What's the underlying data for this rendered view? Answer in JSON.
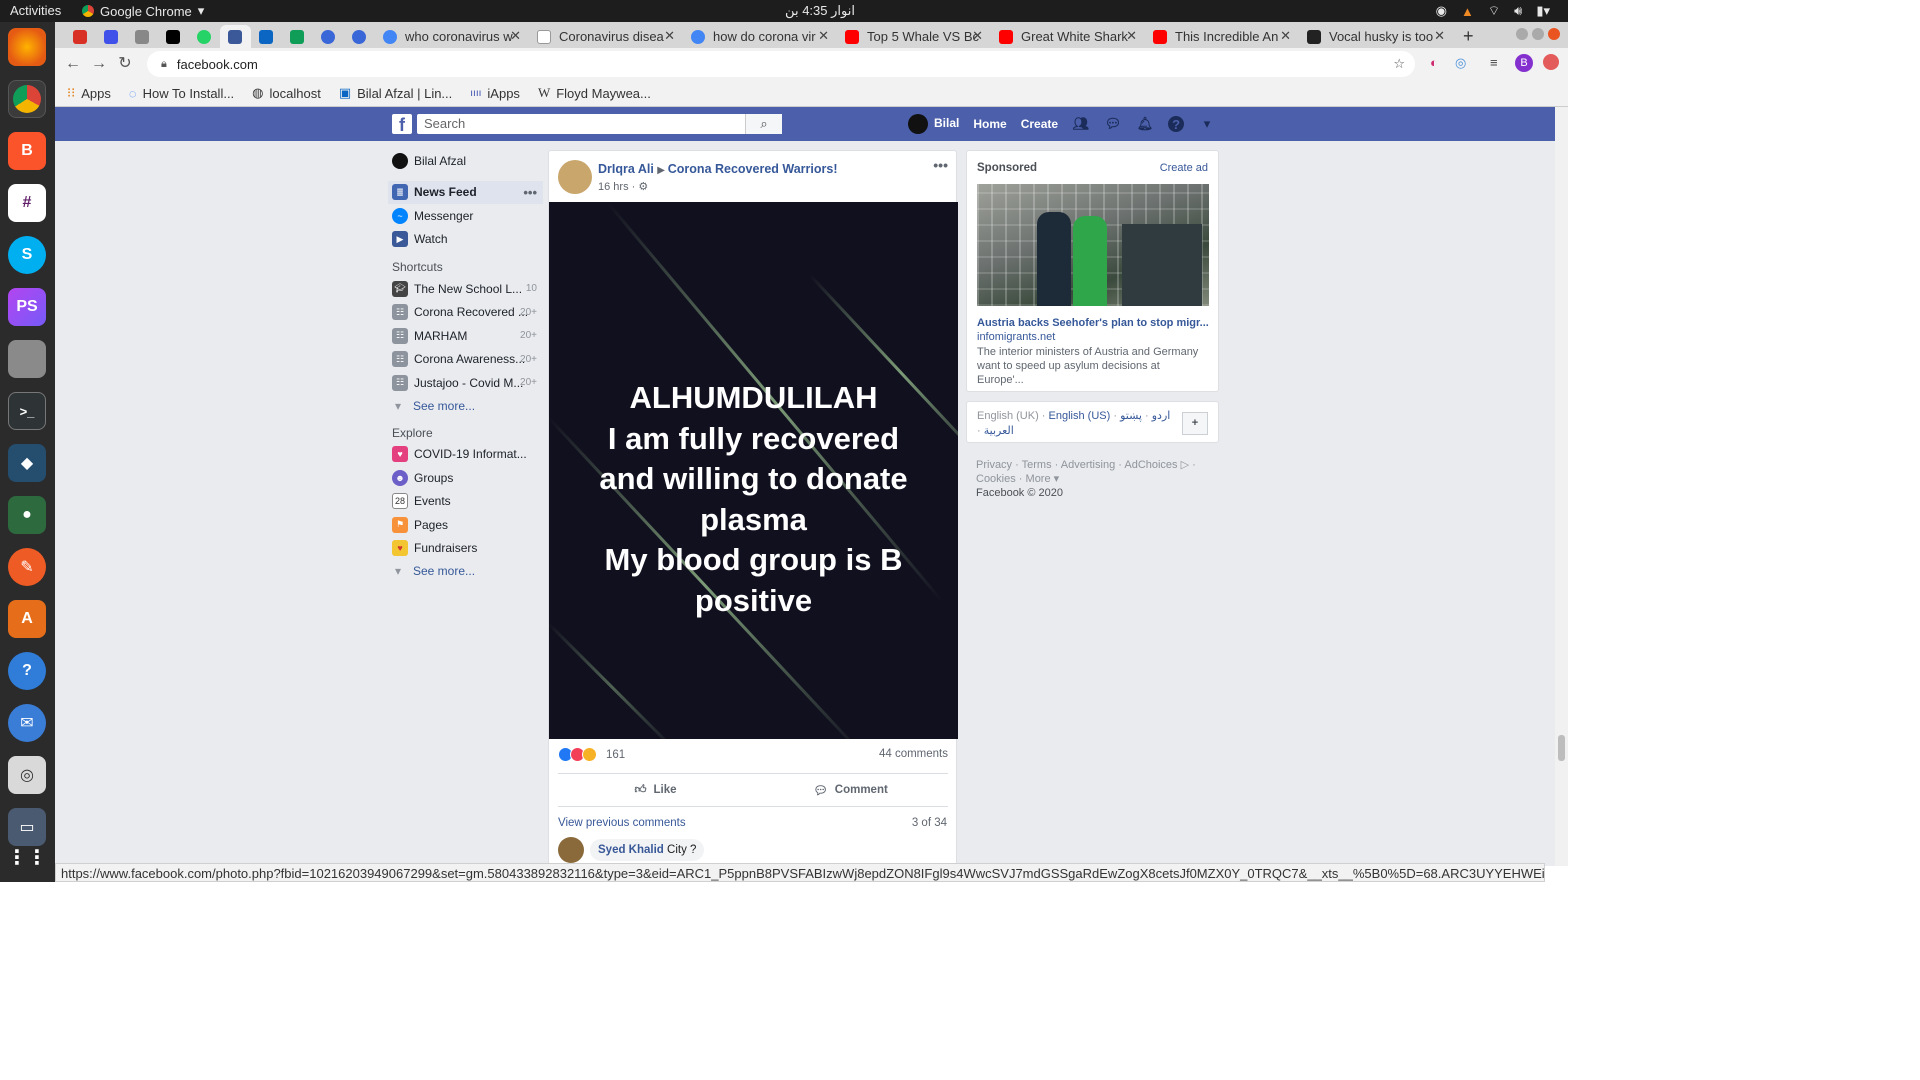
{
  "os": {
    "activities": "Activities",
    "app_name": "Google Chrome",
    "clock": "انوار 4:35 بن"
  },
  "browser": {
    "tabs": [
      {
        "title": "who coronavirus w"
      },
      {
        "title": "Coronavirus disea"
      },
      {
        "title": "how do corona vir"
      },
      {
        "title": "Top 5 Whale VS Bc"
      },
      {
        "title": "Great White Shark"
      },
      {
        "title": "This Incredible An"
      },
      {
        "title": "Vocal husky is too"
      }
    ],
    "url": "facebook.com",
    "bookmarks": [
      "Apps",
      "How To Install...",
      "localhost",
      "Bilal Afzal | Lin...",
      "iApps",
      "Floyd Maywea..."
    ],
    "status_url": "https://www.facebook.com/photo.php?fbid=10216203949067299&set=gm.580433892832116&type=3&eid=ARC1_P5ppnB8PVSFABIzwWj8epdZON8IFgl9s4WwcSVJ7mdGSSgaRdEwZogX8cetsJf0MZX0Y_0TRQC7&__xts__%5B0%5D=68.ARC3UYYEHWEiWOhlG-65ys4Mx..."
  },
  "fb": {
    "search_placeholder": "Search",
    "user_short": "Bilal",
    "home": "Home",
    "create": "Create",
    "user_full": "Bilal Afzal",
    "nav": [
      {
        "label": "News Feed"
      },
      {
        "label": "Messenger"
      },
      {
        "label": "Watch"
      }
    ],
    "shortcuts_title": "Shortcuts",
    "shortcuts": [
      {
        "label": "The New School L...",
        "count": "10"
      },
      {
        "label": "Corona Recovered ...",
        "count": "20+"
      },
      {
        "label": "MARHAM",
        "count": "20+"
      },
      {
        "label": "Corona Awareness...",
        "count": "20+"
      },
      {
        "label": "Justajoo - Covid M...",
        "count": "20+"
      }
    ],
    "see_more": "See more...",
    "explore_title": "Explore",
    "explore": [
      {
        "label": "COVID-19 Informat..."
      },
      {
        "label": "Groups"
      },
      {
        "label": "Events"
      },
      {
        "label": "Pages"
      },
      {
        "label": "Fundraisers"
      }
    ],
    "post": {
      "author": "DrIqra Ali",
      "group": "Corona Recovered Warriors!",
      "time": "16 hrs ·",
      "image_lines": [
        "ALHUMDULILAH",
        "I am fully recovered",
        "and willing to donate",
        "plasma",
        "My blood group is B",
        "positive"
      ],
      "reactions": "161",
      "comments": "44 comments",
      "like": "Like",
      "comment": "Comment",
      "view_previous": "View previous comments",
      "comment_page": "3 of 34",
      "commenter": "Syed Khalid",
      "comment_text": "City ?"
    },
    "sponsored": {
      "title": "Sponsored",
      "create_ad": "Create ad",
      "ad_title": "Austria backs Seehofer's plan to stop migr...",
      "ad_domain": "infomigrants.net",
      "ad_desc": "The interior ministers of Austria and Germany want to speed up asylum decisions at Europe'..."
    },
    "languages": {
      "uk": "English (UK)",
      "us": "English (US)",
      "ur": "اردو",
      "ps": "پښتو",
      "ar": "العربية"
    },
    "footer": {
      "links": [
        "Privacy",
        "Terms",
        "Advertising",
        "AdChoices",
        "Cookies",
        "More"
      ],
      "copyright": "Facebook © 2020"
    }
  }
}
